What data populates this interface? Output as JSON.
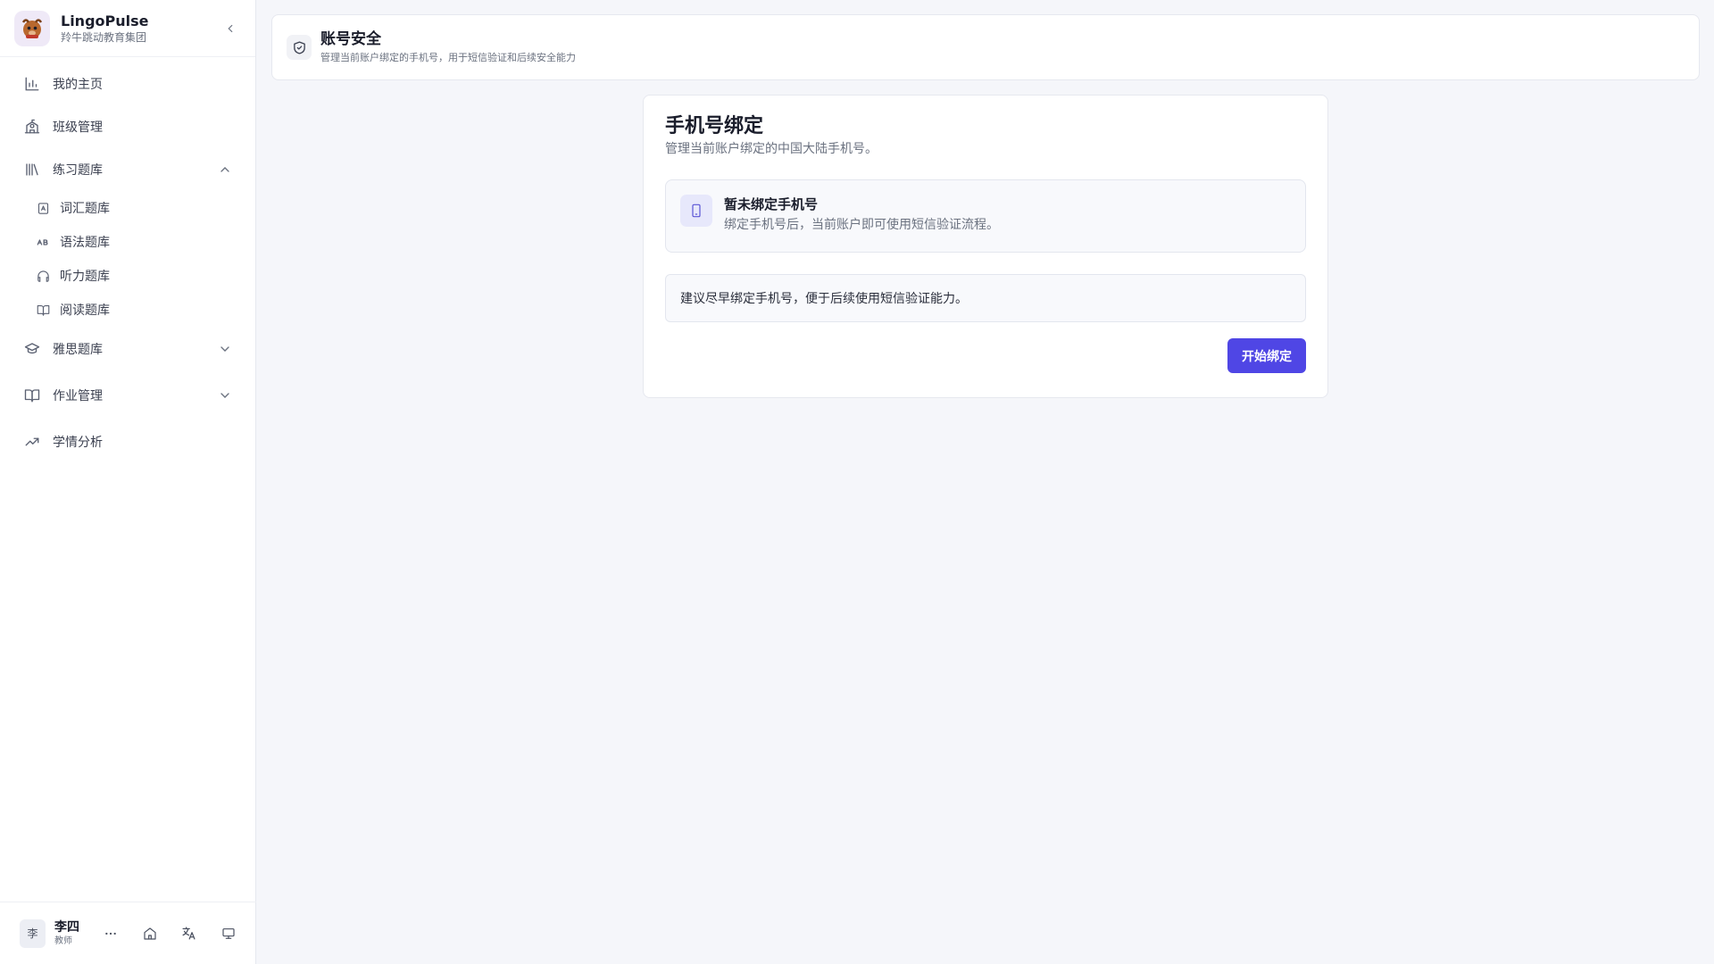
{
  "app": {
    "name": "LingoPulse",
    "org": "羚牛跳动教育集团"
  },
  "sidebar": {
    "items": [
      {
        "label": "我的主页",
        "icon": "bar-chart-icon"
      },
      {
        "label": "班级管理",
        "icon": "school-icon"
      },
      {
        "label": "练习题库",
        "icon": "library-icon",
        "expanded": true,
        "children": [
          {
            "label": "词汇题库",
            "icon": "vocabulary-icon"
          },
          {
            "label": "语法题库",
            "icon": "grammar-ab-icon"
          },
          {
            "label": "听力题库",
            "icon": "headphones-icon"
          },
          {
            "label": "阅读题库",
            "icon": "book-open-icon"
          }
        ]
      },
      {
        "label": "雅思题库",
        "icon": "graduation-cap-icon",
        "expanded": false
      },
      {
        "label": "作业管理",
        "icon": "book-icon",
        "expanded": false
      },
      {
        "label": "学情分析",
        "icon": "trending-up-icon"
      }
    ]
  },
  "user": {
    "avatar_text": "李",
    "name": "李四",
    "role": "教师",
    "actions": [
      "more-icon",
      "home-icon",
      "translate-icon",
      "monitor-icon"
    ]
  },
  "header": {
    "title": "账号安全",
    "subtitle": "管理当前账户绑定的手机号，用于短信验证和后续安全能力"
  },
  "card": {
    "title": "手机号绑定",
    "subtitle": "管理当前账户绑定的中国大陆手机号。",
    "status_title": "暂未绑定手机号",
    "status_desc": "绑定手机号后，当前账户即可使用短信验证流程。",
    "tip": "建议尽早绑定手机号，便于后续使用短信验证能力。",
    "button_label": "开始绑定"
  },
  "colors": {
    "accent": "#4f46e5",
    "background": "#f5f6fa"
  }
}
